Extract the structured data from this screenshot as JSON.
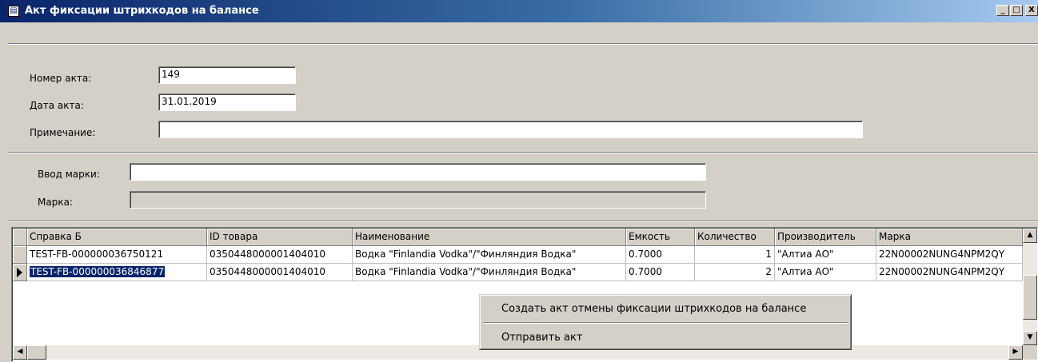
{
  "window": {
    "title": "Акт фиксации штрихкодов на балансе",
    "app_icon": "document-icon",
    "minimize_glyph": "_",
    "maximize_glyph": "□",
    "close_glyph": "X"
  },
  "form": {
    "act_number_label": "Номер акта:",
    "act_number_value": "149",
    "act_date_label": "Дата акта:",
    "act_date_value": "31.01.2019",
    "note_label": "Примечание:",
    "note_value": "",
    "mark_input_label": "Ввод марки:",
    "mark_input_value": "",
    "mark_label": "Марка:",
    "mark_value": ""
  },
  "grid": {
    "columns": [
      "Справка Б",
      "ID товара",
      "Наименование",
      "Емкость",
      "Количество",
      "Производитель",
      "Марка"
    ],
    "rows": [
      [
        "TEST-FB-000000036750121",
        "0350448000001404010",
        "Водка \"Finlandia Vodka\"/\"Финляндия Водка\"",
        "0.7000",
        "1",
        "\"Алтиа АО\"",
        "22N00002NUNG4NPM2QY"
      ],
      [
        "TEST-FB-000000036846877",
        "0350448000001404010",
        "Водка \"Finlandia Vodka\"/\"Финляндия Водка\"",
        "0.7000",
        "2",
        "\"Алтиа АО\"",
        "22N00002NUNG4NPM2QY"
      ]
    ],
    "selected_row": 2
  },
  "context_menu": {
    "items": [
      "Создать акт отмены фиксации штрихкодов на балансе",
      "Отправить акт"
    ]
  },
  "colors": {
    "title_gradient_start": "#0a246a",
    "selection": "#0a246a",
    "face": "#d4d0c8"
  }
}
